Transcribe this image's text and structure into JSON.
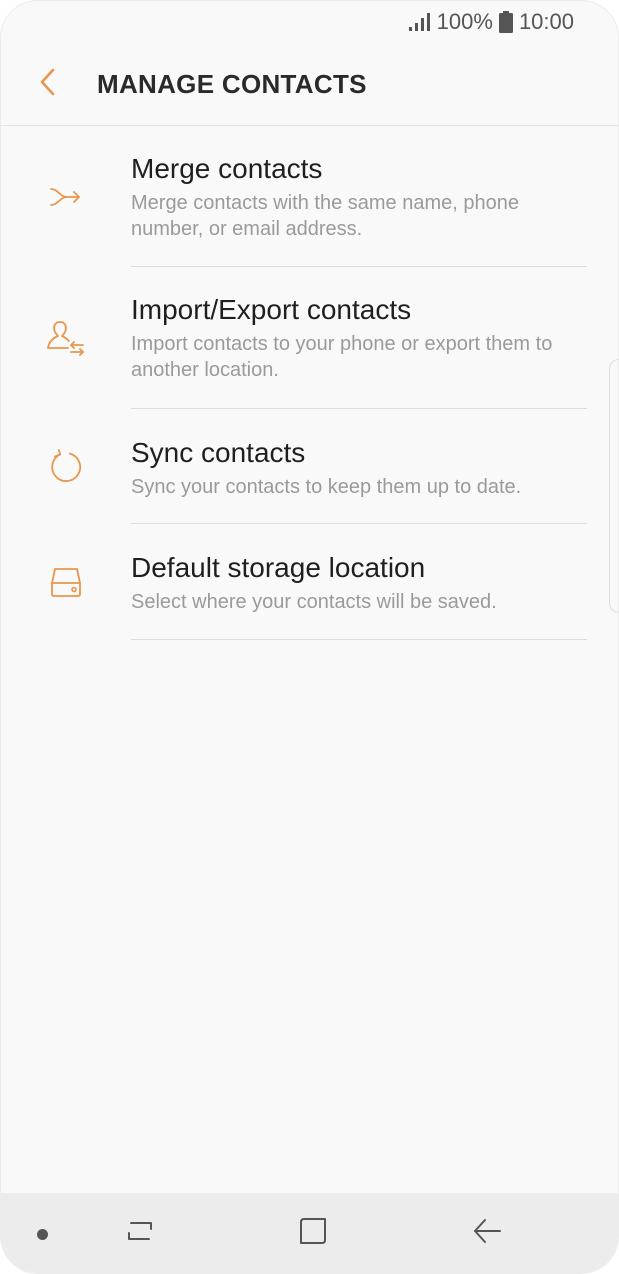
{
  "status_bar": {
    "battery": "100%",
    "time": "10:00",
    "signal_icon": "signal-icon",
    "battery_icon": "battery-icon"
  },
  "header": {
    "back_icon": "chevron-left-icon",
    "title": "MANAGE CONTACTS"
  },
  "items": [
    {
      "icon": "merge-icon",
      "title": "Merge contacts",
      "description": "Merge contacts with the same name, phone number, or email address."
    },
    {
      "icon": "import-export-icon",
      "title": "Import/Export contacts",
      "description": "Import contacts to your phone or export them to another location."
    },
    {
      "icon": "sync-icon",
      "title": "Sync contacts",
      "description": "Sync your contacts to keep them up to date."
    },
    {
      "icon": "storage-icon",
      "title": "Default storage location",
      "description": "Select where your contacts will be saved."
    }
  ],
  "nav": {
    "recent_icon": "recent-apps-icon",
    "home_icon": "home-icon",
    "back_icon": "back-arrow-icon"
  },
  "colors": {
    "accent": "#e8964a",
    "background": "#f9f9f9",
    "title_text": "#2a2a2a",
    "secondary_text": "#9a9a9a",
    "nav_background": "#ececec"
  }
}
